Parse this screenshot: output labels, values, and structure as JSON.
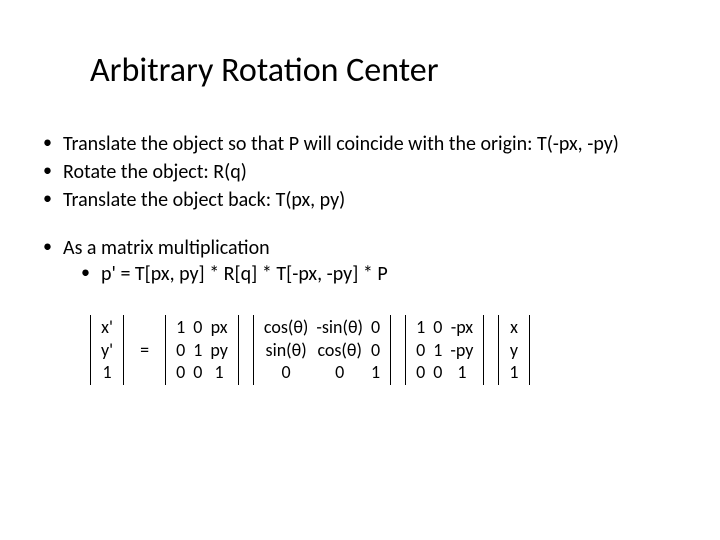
{
  "title": "Arbitrary Rotation Center",
  "bullets": {
    "b1": "Translate the object so that P will coincide with the origin:  T(-px, -py)",
    "b2": "Rotate the object: R(q)",
    "b3": "Translate the object back:   T(px, py)",
    "b4": "As a matrix multiplication",
    "b4a": "p' = T[px, py] * R[q] * T[-px, -py] * P"
  },
  "eq": "=",
  "m": {
    "v1": {
      "r1": "x'",
      "r2": "y'",
      "r3": "1"
    },
    "t1": {
      "r1c1": "1",
      "r1c2": "0",
      "r1c3": "px",
      "r2c1": "0",
      "r2c2": "1",
      "r2c3": "py",
      "r3c1": "0",
      "r3c2": "0",
      "r3c3": "1"
    },
    "rот": {
      "r1c1": "cos(θ)",
      "r1c2": "-sin(θ)",
      "r1c3": "0",
      "r2c1": "sin(θ)",
      "r2c2": "cos(θ)",
      "r2c3": "0",
      "r3c1": "0",
      "r3c2": "0",
      "r3c3": "1"
    },
    "t2": {
      "r1c1": "1",
      "r1c2": "0",
      "r1c3": "-px",
      "r2c1": "0",
      "r2c2": "1",
      "r2c3": "-py",
      "r3c1": "0",
      "r3c2": "0",
      "r3c3": "1"
    },
    "v2": {
      "r1": "x",
      "r2": "y",
      "r3": "1"
    }
  }
}
